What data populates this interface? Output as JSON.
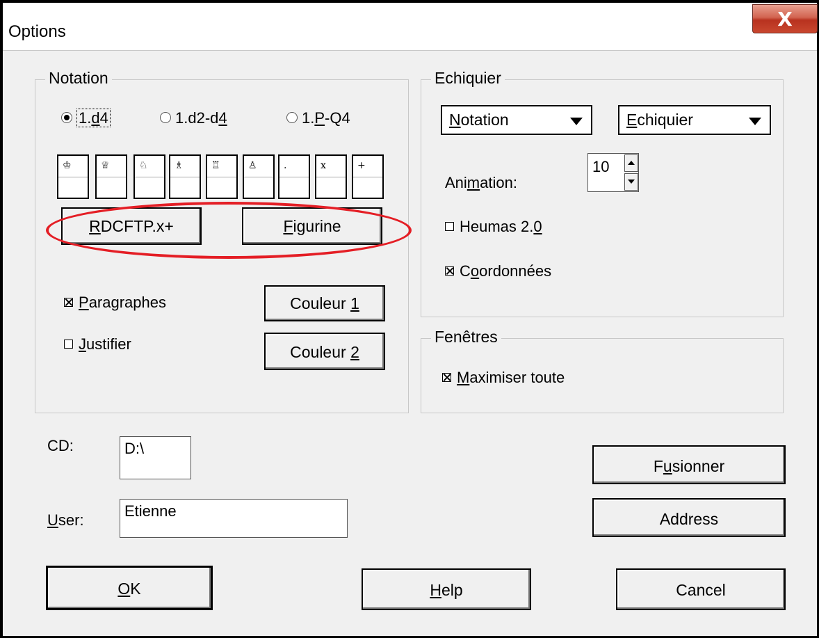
{
  "window": {
    "title": "Options",
    "close_glyph": "X"
  },
  "notation": {
    "group_label": "Notation",
    "radios": [
      {
        "pre": "1.",
        "u": "d",
        "post": "4",
        "selected": true
      },
      {
        "pre": "1.d2-d",
        "u": "4",
        "post": "",
        "selected": false
      },
      {
        "pre": "1.",
        "u": "P",
        "post": "-Q4",
        "selected": false
      }
    ],
    "piece_symbols": [
      "♔",
      "♕",
      "♘",
      "♗",
      "♖",
      "♙",
      ".",
      "x",
      "+"
    ],
    "btn_letters": {
      "u": "R",
      "post": "DCFTP.x+"
    },
    "btn_figurine": {
      "u": "F",
      "post": "igurine"
    },
    "paragraphes": {
      "u": "P",
      "post": "aragraphes",
      "checked": true
    },
    "justifier": {
      "u": "J",
      "post": "ustifier",
      "checked": false
    },
    "couleur1": {
      "pre": "Couleur ",
      "u": "1"
    },
    "couleur2": {
      "pre": "Couleur ",
      "u": "2"
    }
  },
  "echiquier": {
    "group_label": "Echiquier",
    "dropdown_notation": {
      "u": "N",
      "post": "otation"
    },
    "dropdown_echiquier": {
      "u": "E",
      "post": "chiquier"
    },
    "animation_label": {
      "pre": "Ani",
      "u": "m",
      "post": "ation:"
    },
    "animation_value": "10",
    "heumas": {
      "pre": "Heumas 2.",
      "u": "0",
      "checked": false
    },
    "coordonnees": {
      "pre": "C",
      "u": "o",
      "post": "ordonnées",
      "checked": true
    }
  },
  "fenetres": {
    "group_label": "Fenêtres",
    "maximiser": {
      "u": "M",
      "post": "aximiser toute",
      "checked": true
    }
  },
  "cd": {
    "label": "CD:",
    "value": "D:\\"
  },
  "user": {
    "u": "U",
    "post": "ser:",
    "value": "Etienne"
  },
  "buttons": {
    "fusionner": {
      "pre": "F",
      "u": "u",
      "post": "sionner"
    },
    "address": "Address",
    "ok": {
      "u": "O",
      "post": "K"
    },
    "help": {
      "u": "H",
      "post": "elp"
    },
    "cancel": "Cancel"
  },
  "colors": {
    "highlight_ellipse": "#e41e25",
    "close_button": "#c9472f"
  },
  "icons": {
    "close": "close-icon",
    "dropdown": "triangle-down-icon"
  }
}
